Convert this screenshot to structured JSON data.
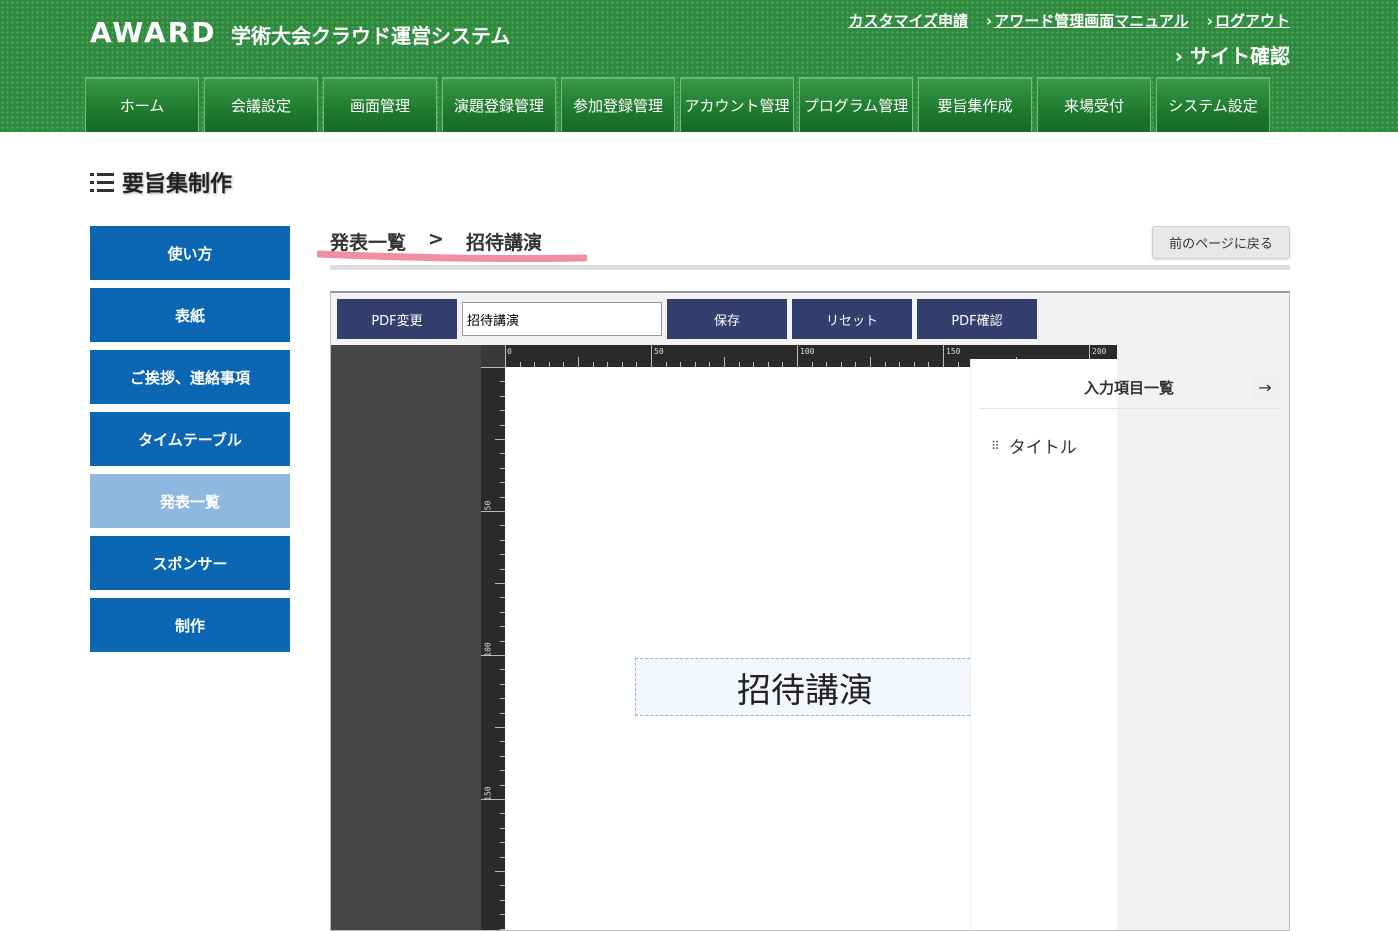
{
  "header": {
    "logo": "AWARD",
    "system_title": "学術大会クラウド運営システム",
    "top_links": [
      {
        "label": "カスタマイズ申請",
        "has_chevron": false
      },
      {
        "label": "アワード管理画面マニュアル",
        "has_chevron": true
      },
      {
        "label": "ログアウト",
        "has_chevron": true
      }
    ],
    "site_check": "サイト確認",
    "nav_tabs": [
      "ホーム",
      "会議設定",
      "画面管理",
      "演題登録管理",
      "参加登録管理",
      "アカウント管理",
      "プログラム管理",
      "要旨集作成",
      "来場受付",
      "システム設定"
    ]
  },
  "page": {
    "title": "要旨集制作",
    "title_icon": "list-icon"
  },
  "sidebar": {
    "items": [
      {
        "label": "使い方",
        "active": false
      },
      {
        "label": "表紙",
        "active": false
      },
      {
        "label": "ご挨拶、連絡事項",
        "active": false
      },
      {
        "label": "タイムテーブル",
        "active": false
      },
      {
        "label": "発表一覧",
        "active": true
      },
      {
        "label": "スポンサー",
        "active": false
      },
      {
        "label": "制作",
        "active": false
      }
    ]
  },
  "breadcrumb": {
    "items": [
      "発表一覧",
      ">",
      "招待講演"
    ]
  },
  "back_button": "前のページに戻る",
  "editor": {
    "toolbar": {
      "pdf_change": "PDF変更",
      "name_value": "招待講演",
      "save": "保存",
      "reset": "リセット",
      "pdf_check": "PDF確認"
    },
    "ruler_top_labels": [
      "0",
      "50",
      "100",
      "150",
      "200"
    ],
    "ruler_left_labels": [
      "50",
      "100",
      "150"
    ],
    "canvas_title": "招待講演",
    "panel": {
      "title": "入力項目一覧",
      "arrow_icon": "arrow-right-icon",
      "items": [
        "タイトル"
      ]
    }
  },
  "colors": {
    "header_green": "#2e8b3e",
    "sidebar_blue": "#0b66b4",
    "sidebar_active": "#8fb8e0",
    "toolbar_navy": "#333f6e",
    "underline_pink": "#ef8fa0"
  }
}
